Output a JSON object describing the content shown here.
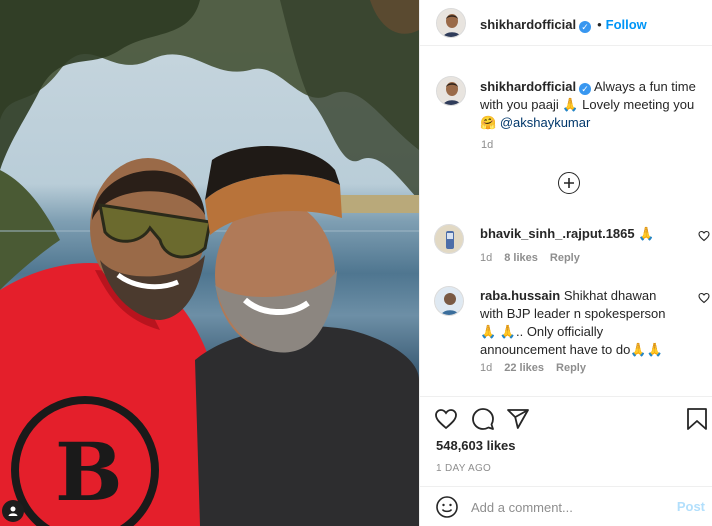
{
  "post": {
    "username": "shikhardofficial",
    "follow_label": "Follow",
    "separator": "•"
  },
  "caption": {
    "username": "shikhardofficial",
    "text": "Always a fun time with you paaji 🙏 Lovely meeting you 🤗 ",
    "mention": "@akshaykumar",
    "time": "1d"
  },
  "comments": [
    {
      "username": "bhavik_sinh_.rajput.1865",
      "text": "🙏",
      "time": "1d",
      "likes": "8 likes",
      "reply": "Reply"
    },
    {
      "username": "raba.hussain",
      "text": "Shikhat dhawan with BJP leader n spokesperson 🙏 🙏.. Only officially announcement have to do🙏🙏",
      "time": "1d",
      "likes": "22 likes",
      "reply": "Reply"
    }
  ],
  "likes_count": "548,603 likes",
  "date": "1 DAY AGO",
  "add_comment": {
    "placeholder": "Add a comment...",
    "post_label": "Post"
  },
  "icons": {
    "verified": "verified-badge-icon",
    "load_more": "plus-circle-icon",
    "like": "heart-icon",
    "comment": "speech-bubble-icon",
    "share": "paper-plane-icon",
    "save": "bookmark-icon",
    "emoji": "smiley-icon"
  }
}
